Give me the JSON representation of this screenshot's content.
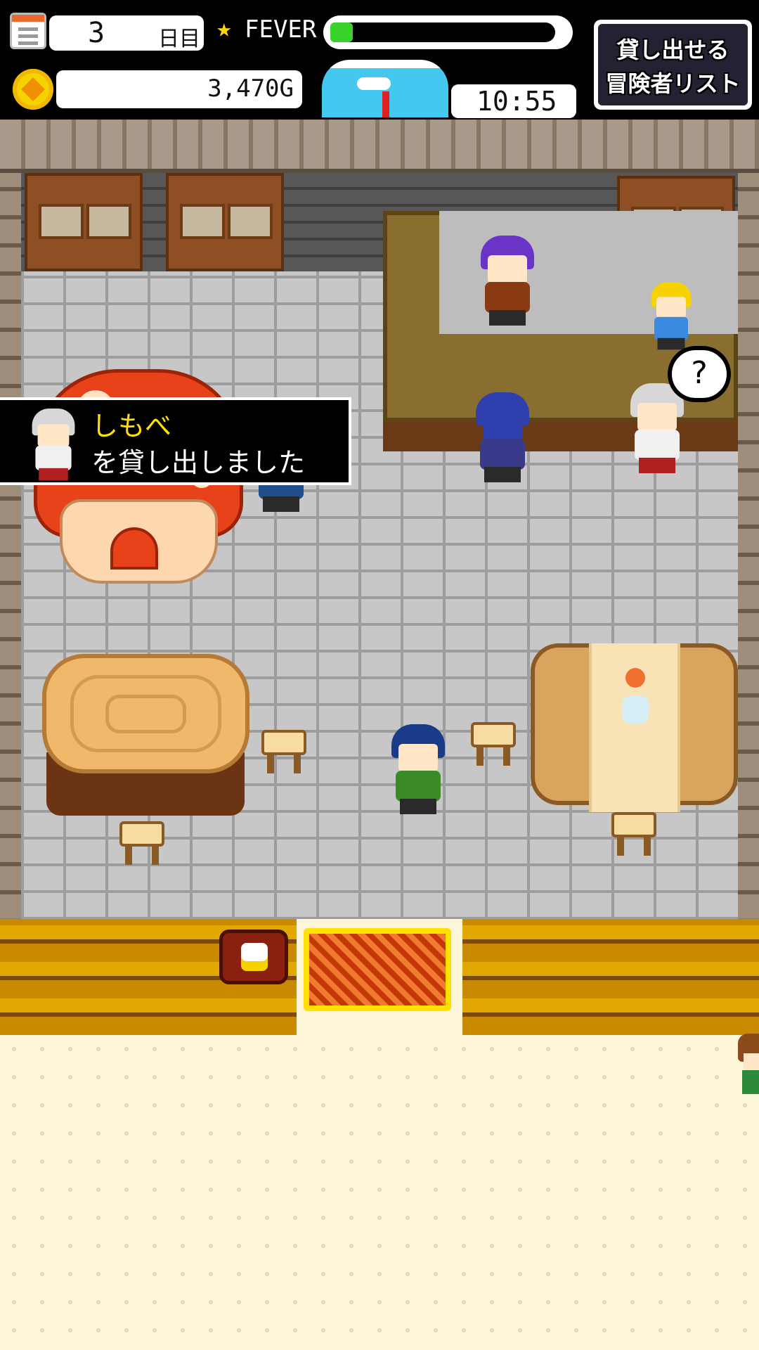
{
  "hud": {
    "day_number": "3",
    "day_unit": "日目",
    "fever_label": "FEVER",
    "fever_level": 0.1,
    "gold": "3,470G",
    "time": "10:55",
    "list_button_line1": "貸し出せる",
    "list_button_line2": "冒険者リスト"
  },
  "notice": {
    "name": "しもべ",
    "message": "を貸し出しました"
  },
  "bubble": "?",
  "colors": {
    "fever_fill": "#39d22a",
    "notice_name": "#ffe000",
    "floor": "#c7c7c7",
    "outside": "#fcf5d8"
  },
  "icons": [
    "menu-icon",
    "star-icon",
    "coin-icon",
    "sky-clock-icon",
    "mug-sign-icon"
  ]
}
